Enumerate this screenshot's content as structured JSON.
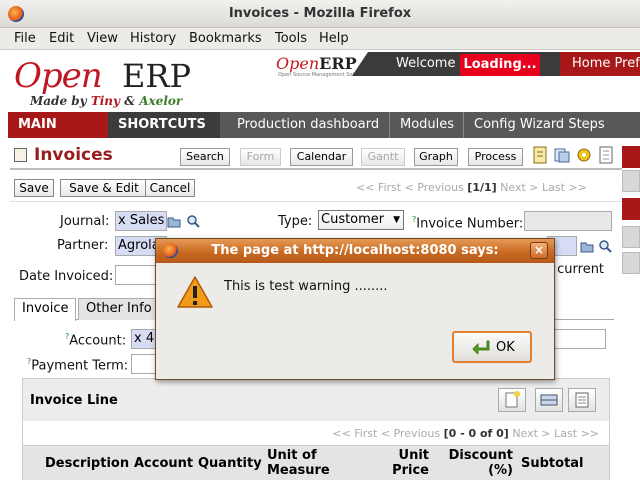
{
  "browser": {
    "window_title": "Invoices - Mozilla Firefox",
    "menu": [
      "File",
      "Edit",
      "View",
      "History",
      "Bookmarks",
      "Tools",
      "Help"
    ]
  },
  "header": {
    "logo_open": "Open",
    "logo_erp": "ERP",
    "made_by": "Made by",
    "tiny": "Tiny",
    "amp": "&",
    "axelor": "Axelor",
    "mini_logo_open": "Open",
    "mini_logo_erp": "ERP",
    "mini_tagline": "Open Source Management Solution",
    "welcome": "Welcome A",
    "loading": "Loading...",
    "home_links": "Home  Pref"
  },
  "nav": {
    "main_menu": "MAIN MENU",
    "shortcuts": "SHORTCUTS",
    "items": [
      "Production dashboard",
      "Modules",
      "Config Wizard Steps"
    ]
  },
  "page": {
    "title": "Invoices",
    "views": [
      "Search",
      "Form",
      "Calendar",
      "Gantt",
      "Graph",
      "Process"
    ],
    "disabled_views": [
      "Form",
      "Gantt"
    ]
  },
  "actions": {
    "save": "Save",
    "save_edit": "Save & Edit",
    "cancel": "Cancel",
    "pager_first": "<< First",
    "pager_prev": "< Previous",
    "pager_count": "[1/1]",
    "pager_next": "Next >",
    "pager_last": "Last >>"
  },
  "form": {
    "journal_label": "Journal:",
    "journal_value": "x Sales",
    "type_label": "Type:",
    "type_value": "Customer",
    "invoice_number_label": "Invoice Number:",
    "partner_label": "Partner:",
    "partner_value": "Agrola",
    "date_label": "Date Invoiced:",
    "current_hint": "e current",
    "account_label": "Account:",
    "account_value": "x 4",
    "payment_term_label": "Payment Term:",
    "required_mark": "?"
  },
  "tabs": [
    "Invoice",
    "Other Info"
  ],
  "invoice_lines": {
    "title": "Invoice Line",
    "pager_first": "<< First",
    "pager_prev": "< Previous",
    "pager_count": "[0 - 0 of 0]",
    "pager_next": "Next >",
    "pager_last": "Last >>",
    "columns": [
      "Description",
      "Account",
      "Quantity",
      "Unit of Measure",
      "Unit Price",
      "Discount (%)",
      "Subtotal"
    ]
  },
  "dialog": {
    "title": "The page at http://localhost:8080 says:",
    "message": "This is test warning ........",
    "ok": "OK",
    "close": "×"
  },
  "colors": {
    "brand_red": "#a81818",
    "nav_gray": "#585858",
    "loading_red": "#e8001c",
    "dialog_title_orange": "#c96a22",
    "required_field_blue": "#d7dcf5"
  }
}
